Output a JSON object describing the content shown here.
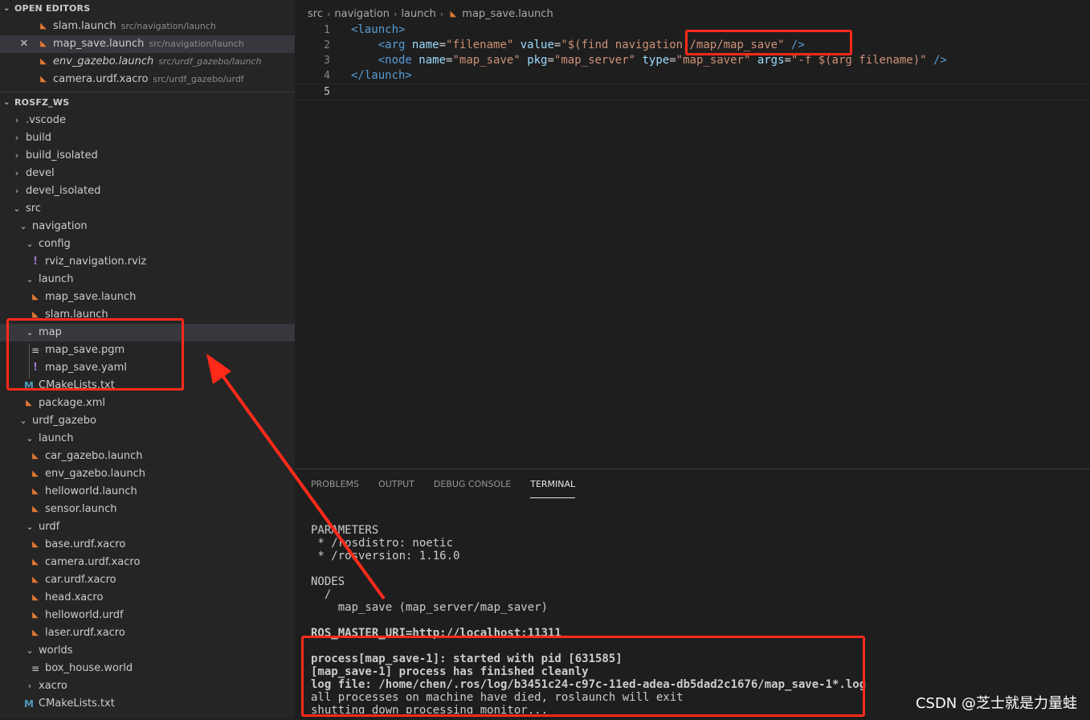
{
  "sidebar": {
    "open_editors_title": "OPEN EDITORS",
    "open_editors": [
      {
        "name": "slam.launch",
        "path": "src/navigation/launch"
      },
      {
        "name": "map_save.launch",
        "path": "src/navigation/launch"
      },
      {
        "name": "env_gazebo.launch",
        "path": "src/urdf_gazebo/launch"
      },
      {
        "name": "camera.urdf.xacro",
        "path": "src/urdf_gazebo/urdf"
      }
    ],
    "workspace_title": "ROSFZ_WS",
    "tree": [
      ".vscode",
      "build",
      "build_isolated",
      "devel",
      "devel_isolated",
      "src",
      "navigation",
      "config",
      "rviz_navigation.rviz",
      "launch",
      "map_save.launch",
      "slam.launch",
      "map",
      "map_save.pgm",
      "map_save.yaml",
      "CMakeLists.txt",
      "package.xml",
      "urdf_gazebo",
      "launch",
      "car_gazebo.launch",
      "env_gazebo.launch",
      "helloworld.launch",
      "sensor.launch",
      "urdf",
      "base.urdf.xacro",
      "camera.urdf.xacro",
      "car.urdf.xacro",
      "head.xacro",
      "helloworld.urdf",
      "laser.urdf.xacro",
      "worlds",
      "box_house.world",
      "xacro",
      "CMakeLists.txt"
    ]
  },
  "editor": {
    "breadcrumb": [
      "src",
      "navigation",
      "launch",
      "map_save.launch"
    ],
    "line_numbers": [
      "1",
      "2",
      "3",
      "4",
      "5"
    ],
    "code": {
      "l1_open": "<launch>",
      "l2_tag": "<arg",
      "l2_a1": " name",
      "l2_eq1": "=",
      "l2_v1": "\"filename\"",
      "l2_a2": " value",
      "l2_eq2": "=",
      "l2_v2": "\"$(find navigation)/map/map_save\"",
      "l2_close": " />",
      "l3_tag": "<node",
      "l3_a1": " name",
      "l3_v1": "\"map_save\"",
      "l3_a2": " pkg",
      "l3_v2": "\"map_server\"",
      "l3_a3": " type",
      "l3_v3": "\"map_saver\"",
      "l3_a4": " args",
      "l3_v4": "\"-f $(arg filename)\"",
      "l3_close": " />",
      "l4_close": "</launch>"
    }
  },
  "panel": {
    "tabs": [
      "PROBLEMS",
      "OUTPUT",
      "DEBUG CONSOLE",
      "TERMINAL"
    ],
    "terminal_lines": [
      "PARAMETERS",
      " * /rosdistro: noetic",
      " * /rosversion: 1.16.0",
      "",
      "NODES",
      "  /",
      "    map_save (map_server/map_saver)",
      "",
      "ROS_MASTER_URI=http://localhost:11311",
      "",
      "process[map_save-1]: started with pid [631585]",
      "[map_save-1] process has finished cleanly",
      "log file: /home/chen/.ros/log/b3451c24-c97c-11ed-adea-db5dad2c1676/map_save-1*.log",
      "all processes on machine have died, roslaunch will exit",
      "shutting down processing monitor..."
    ]
  },
  "watermark": "CSDN @芝士就是力量蛙",
  "colors": {
    "annotation_red": "#ff2a1a",
    "sidebar_bg": "#252526",
    "editor_bg": "#1e1e1e"
  }
}
